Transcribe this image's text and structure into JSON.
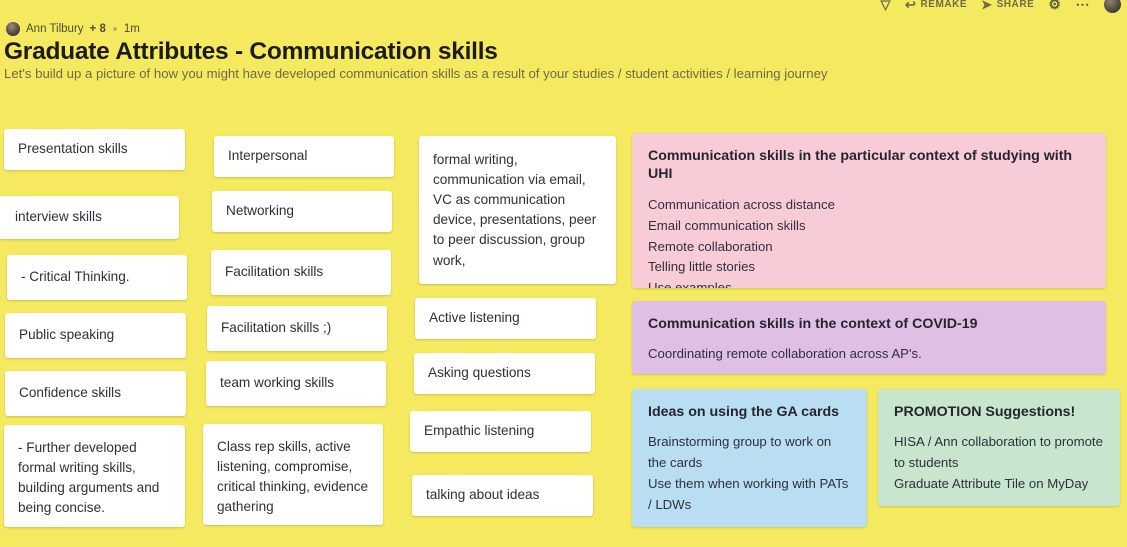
{
  "toolbar": {
    "like_icon": "chevron-down-icon",
    "remake_label": "REMAKE",
    "remake_icon": "remake-arrow-icon",
    "share_label": "SHARE",
    "share_icon": "share-arrow-icon",
    "settings_icon": "gear-icon",
    "more_icon": "more-options-icon",
    "avatar_icon": "user-avatar"
  },
  "byline": {
    "author": "Ann Tilbury",
    "collaborators": "+ 8",
    "time": "1m"
  },
  "header": {
    "title": "Graduate Attributes - Communication skills",
    "subtitle": "Let's build up a picture of how you might have developed communication skills as a result of your studies / student activities / learning journey"
  },
  "columns": [
    {
      "id": "column-1",
      "cards": [
        {
          "text": "Presentation skills"
        },
        {
          "text": "interview skills"
        },
        {
          "text": " - Critical Thinking."
        },
        {
          "text": "Public speaking"
        },
        {
          "text": "Confidence skills"
        },
        {
          "text": " - Further developed formal writing skills, building arguments and being concise."
        }
      ]
    },
    {
      "id": "column-2",
      "cards": [
        {
          "text": "Interpersonal"
        },
        {
          "text": "Networking"
        },
        {
          "text": "Facilitation skills"
        },
        {
          "text": "Facilitation skills ;)"
        },
        {
          "text": "team working skills"
        },
        {
          "text": "Class rep skills, active listening, compromise, critical thinking, evidence gathering"
        }
      ]
    },
    {
      "id": "column-3",
      "cards": [
        {
          "text": "formal writing, communication via email, VC as communication device, presentations, peer to peer discussion, group work,"
        },
        {
          "text": "Active listening"
        },
        {
          "text": "Asking questions"
        },
        {
          "text": "Empathic listening"
        },
        {
          "text": "talking about ideas"
        }
      ]
    }
  ],
  "panels": [
    {
      "id": "panel-uhi",
      "color": "#f8ccd6",
      "title": "Communication skills in the particular context of studying with UHI",
      "lines": [
        "Communication across distance",
        "Email communication skills",
        "Remote collaboration",
        "Telling little stories",
        "Use examples"
      ]
    },
    {
      "id": "panel-covid",
      "color": "#e0bfe5",
      "title": "Communication skills in the context of COVID-19",
      "lines": [
        "Coordinating remote collaboration across AP's."
      ]
    },
    {
      "id": "panel-ga-cards",
      "color": "#b9def1",
      "title": "Ideas on using the GA cards",
      "lines": [
        "Brainstorming group to work on the cards",
        "Use them when working with PATs / LDWs"
      ]
    },
    {
      "id": "panel-promotion",
      "color": "#c8e6ce",
      "title": "PROMOTION Suggestions!",
      "lines": [
        "HISA / Ann collaboration to promote to students",
        "Graduate Attribute Tile on MyDay"
      ]
    }
  ]
}
